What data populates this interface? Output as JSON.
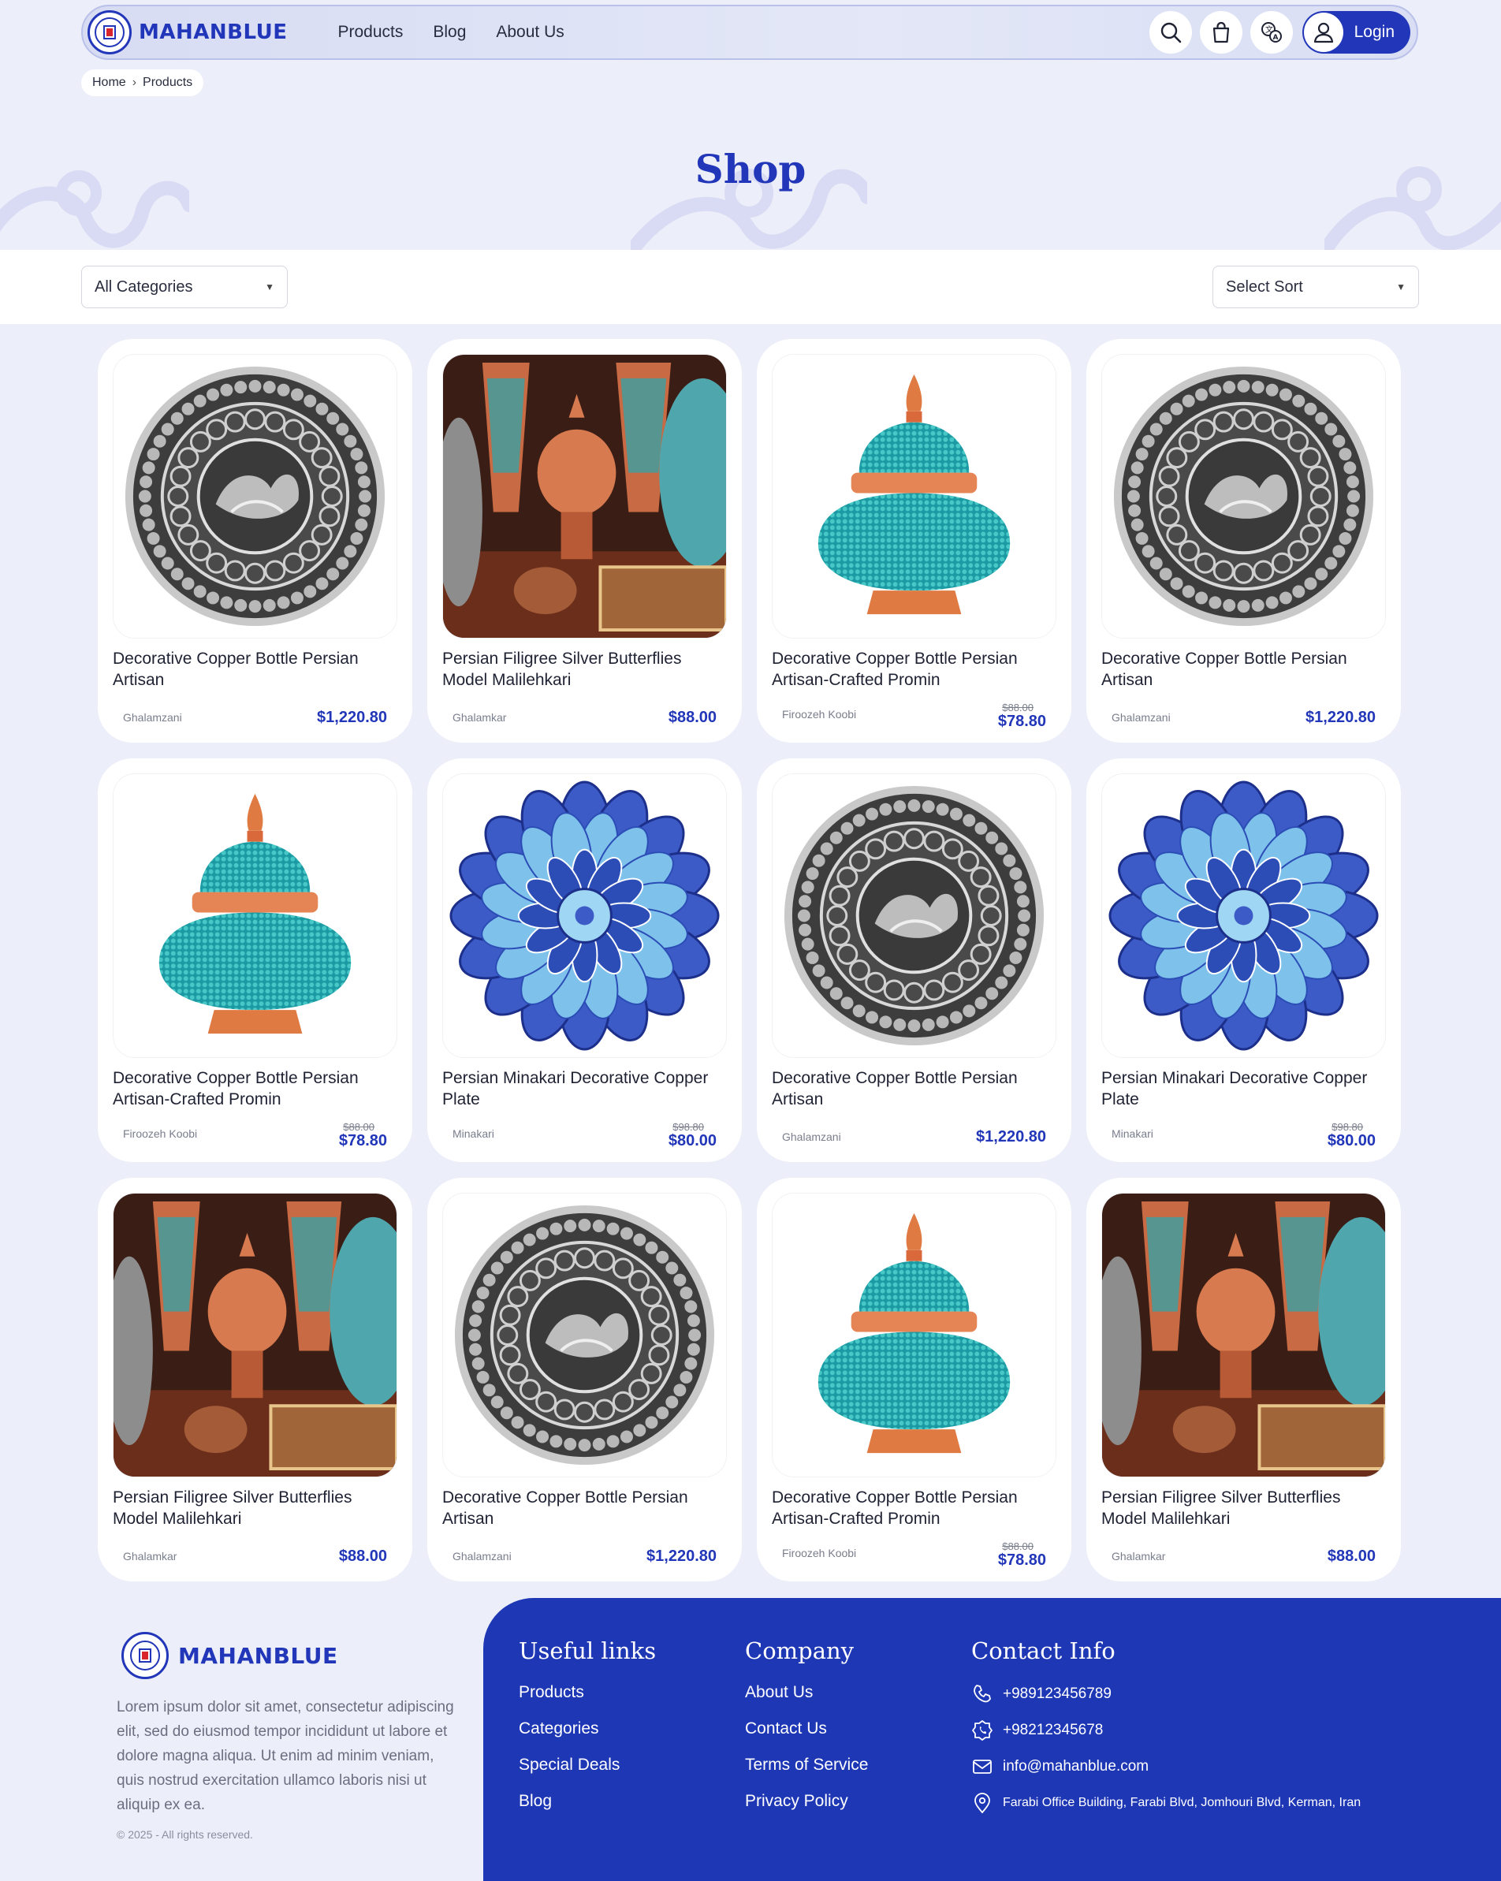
{
  "brand": {
    "name": "MAHANBLUE"
  },
  "nav": {
    "links": [
      "Products",
      "Blog",
      "About Us"
    ],
    "login_label": "Login"
  },
  "icons": {
    "search": "search-icon",
    "cart": "shopping-bag-icon",
    "language": "translate-icon",
    "user": "user-icon"
  },
  "colors": {
    "primary": "#2136b8",
    "background": "#eceef9",
    "footer": "#1e37b5"
  },
  "breadcrumb": {
    "home": "Home",
    "current": "Products"
  },
  "hero": {
    "title": "Shop"
  },
  "filters": {
    "category": "All Categories",
    "sort": "Select Sort"
  },
  "products": [
    {
      "title": "Decorative Copper Bottle Persian Artisan",
      "shop": "Ghalamzani",
      "price": "$1,220.80",
      "old_price": "",
      "image": "engraved-plate"
    },
    {
      "title": "Persian Filigree Silver Butterflies Model Malilehkari",
      "shop": "Ghalamkar",
      "price": "$88.00",
      "old_price": "",
      "image": "handicraft-collection"
    },
    {
      "title": "Decorative Copper Bottle Persian Artisan-Crafted Promin",
      "shop": "Firoozeh Koobi",
      "price": "$78.80",
      "old_price": "$88.00",
      "image": "turquoise-jar"
    },
    {
      "title": "Decorative Copper Bottle Persian Artisan",
      "shop": "Ghalamzani",
      "price": "$1,220.80",
      "old_price": "",
      "image": "engraved-plate"
    },
    {
      "title": "Decorative Copper Bottle Persian Artisan-Crafted Promin",
      "shop": "Firoozeh Koobi",
      "price": "$78.80",
      "old_price": "$88.00",
      "image": "turquoise-jar"
    },
    {
      "title": "Persian Minakari Decorative Copper Plate",
      "shop": "Minakari",
      "price": "$80.00",
      "old_price": "$98.80",
      "image": "minakari-plate"
    },
    {
      "title": "Decorative Copper Bottle Persian Artisan",
      "shop": "Ghalamzani",
      "price": "$1,220.80",
      "old_price": "",
      "image": "engraved-plate"
    },
    {
      "title": "Persian Minakari Decorative Copper Plate",
      "shop": "Minakari",
      "price": "$80.00",
      "old_price": "$98.80",
      "image": "minakari-plate"
    },
    {
      "title": "Persian Filigree Silver Butterflies Model Malilehkari",
      "shop": "Ghalamkar",
      "price": "$88.00",
      "old_price": "",
      "image": "handicraft-collection"
    },
    {
      "title": "Decorative Copper Bottle Persian Artisan",
      "shop": "Ghalamzani",
      "price": "$1,220.80",
      "old_price": "",
      "image": "engraved-plate"
    },
    {
      "title": "Decorative Copper Bottle Persian Artisan-Crafted Promin",
      "shop": "Firoozeh Koobi",
      "price": "$78.80",
      "old_price": "$88.00",
      "image": "turquoise-jar"
    },
    {
      "title": "Persian Filigree Silver Butterflies Model Malilehkari",
      "shop": "Ghalamkar",
      "price": "$88.00",
      "old_price": "",
      "image": "handicraft-collection"
    }
  ],
  "footer": {
    "about": "Lorem ipsum dolor sit amet, consectetur adipiscing elit, sed do eiusmod tempor incididunt ut labore et dolore magna aliqua. Ut enim ad minim veniam, quis nostrud exercitation ullamco laboris nisi ut aliquip ex ea.",
    "copyright": "© 2025 - All rights reserved.",
    "useful_links": {
      "title": "Useful links",
      "items": [
        "Products",
        "Categories",
        "Special Deals",
        "Blog"
      ]
    },
    "company": {
      "title": "Company",
      "items": [
        "About Us",
        "Contact Us",
        "Terms of Service",
        "Privacy Policy"
      ]
    },
    "contact": {
      "title": "Contact Info",
      "phone1": "+989123456789",
      "phone2": "+98212345678",
      "email": "info@mahanblue.com",
      "address": "Farabi Office Building, Farabi Blvd, Jomhouri Blvd, Kerman, Iran"
    }
  }
}
